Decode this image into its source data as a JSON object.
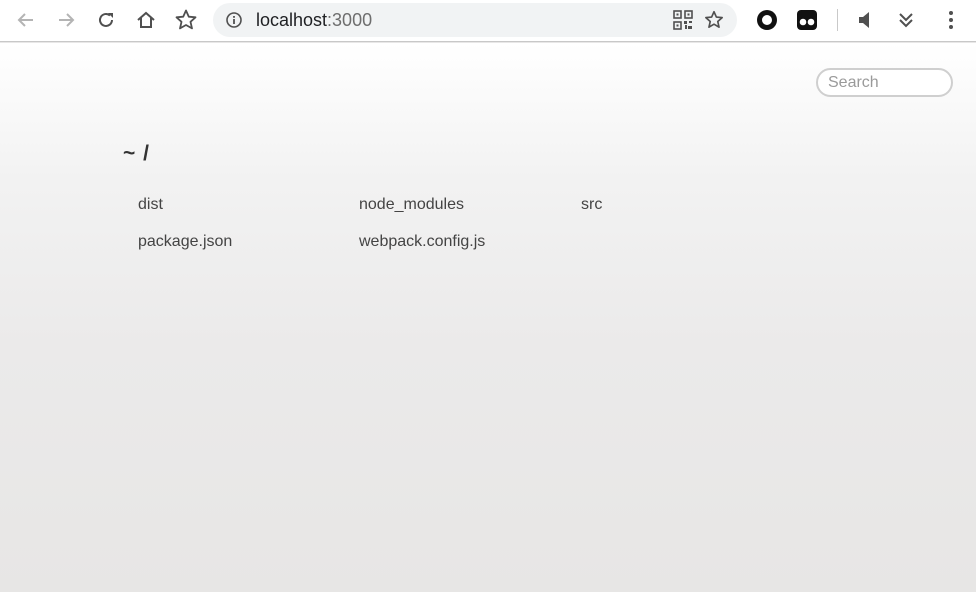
{
  "browser": {
    "url_host": "localhost",
    "url_port": ":3000",
    "icons": [
      "back-arrow-icon",
      "forward-arrow-icon",
      "reload-icon",
      "home-icon",
      "bookmark-star-icon",
      "site-info-icon",
      "qr-code-icon",
      "bookmark-page-star-icon",
      "extension-circle-icon",
      "extension-tampermonkey-icon",
      "mute-speaker-icon",
      "expand-chevrons-icon",
      "menu-kebab-icon"
    ]
  },
  "page": {
    "search_placeholder": "Search",
    "path_title": "~ /",
    "files": [
      {
        "name": "dist"
      },
      {
        "name": "node_modules"
      },
      {
        "name": "src"
      },
      {
        "name": "package.json"
      },
      {
        "name": "webpack.config.js"
      }
    ]
  },
  "colors": {
    "text": "#444444",
    "title": "#333333",
    "omnibox": "#f1f3f4"
  }
}
